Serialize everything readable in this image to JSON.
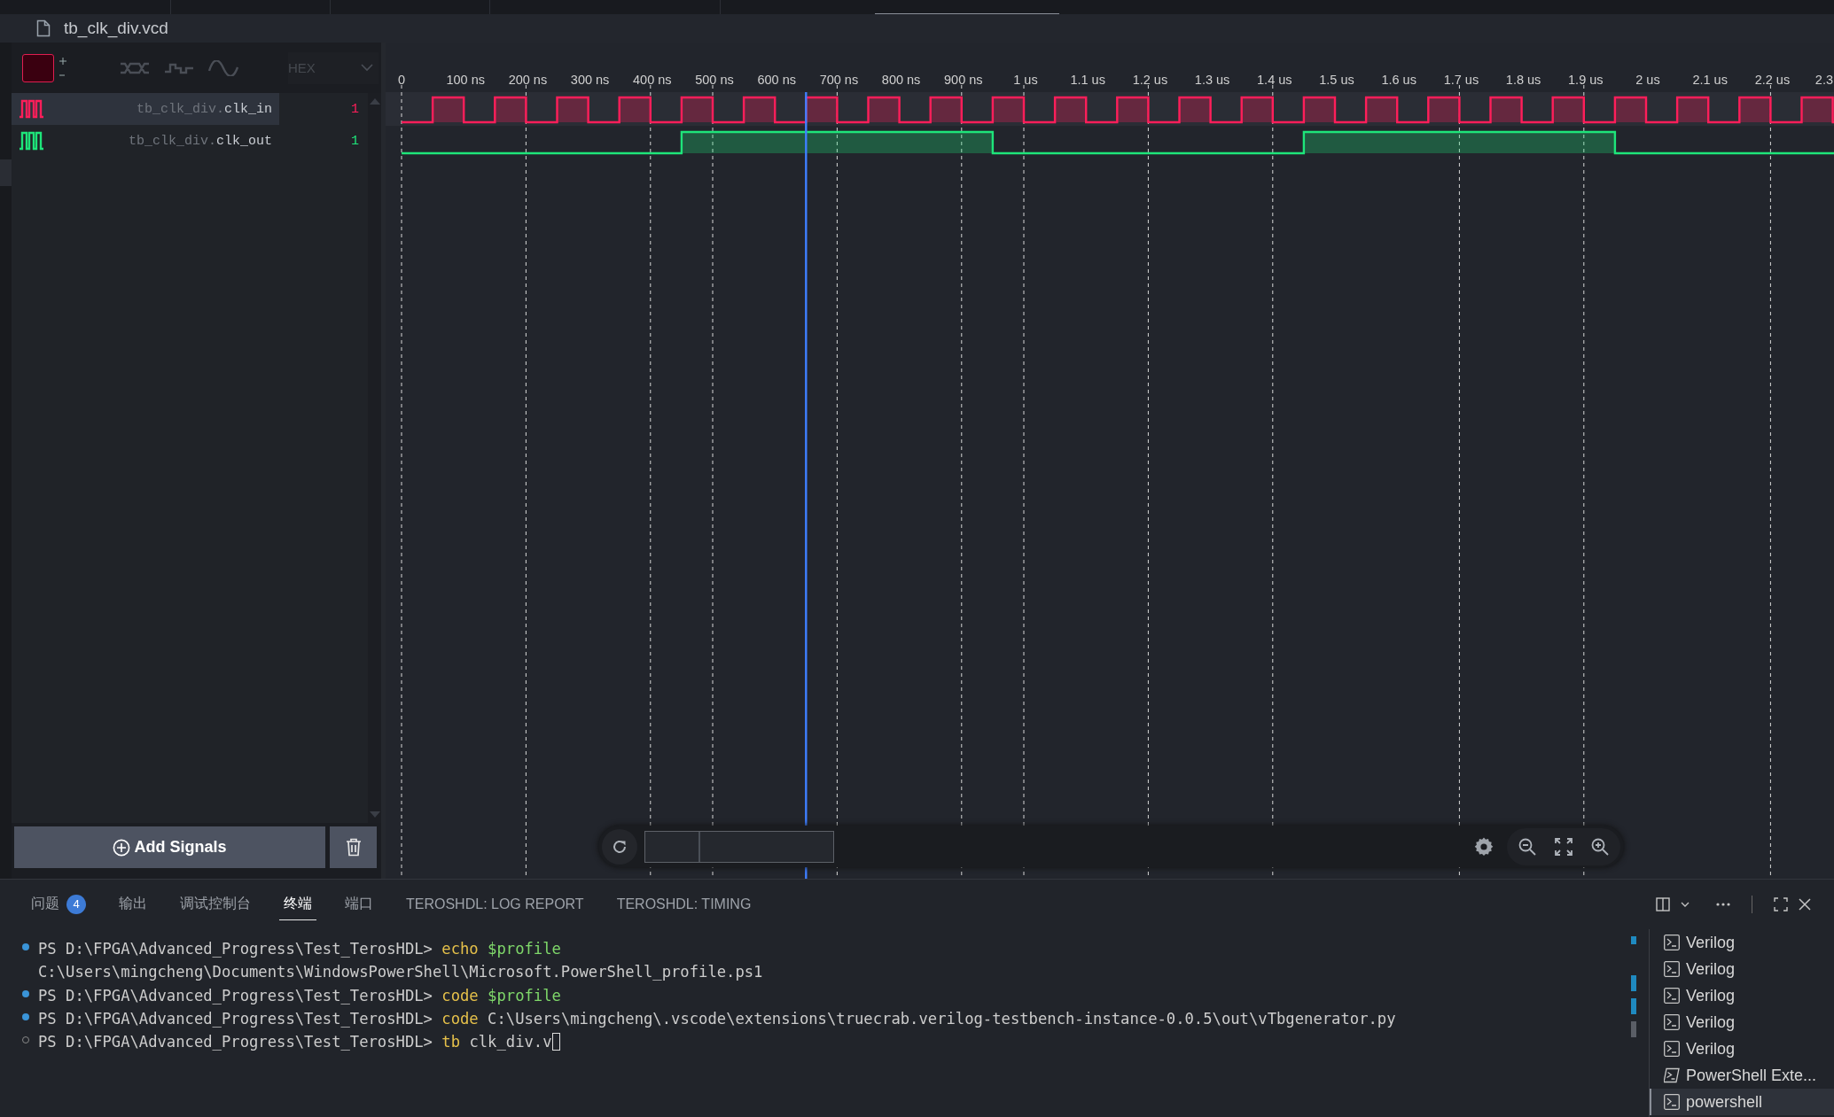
{
  "file": {
    "name": "tb_clk_div.vcd"
  },
  "toolbar": {
    "radix": "HEX",
    "disabled": true
  },
  "signals": [
    {
      "scope": "tb_clk_div.",
      "name": "clk_in",
      "value": "1",
      "color": "#ff1e5a",
      "selected": true
    },
    {
      "scope": "tb_clk_div.",
      "name": "clk_out",
      "value": "1",
      "color": "#1ee57a",
      "selected": false
    }
  ],
  "time_axis": [
    "0",
    "100 ns",
    "200 ns",
    "300 ns",
    "400 ns",
    "500 ns",
    "600 ns",
    "700 ns",
    "800 ns",
    "900 ns",
    "1 us",
    "1.1 us",
    "1.2 us",
    "1.3 us",
    "1.4 us",
    "1.5 us",
    "1.6 us",
    "1.7 us",
    "1.8 us",
    "1.9 us",
    "2 us",
    "2.1 us",
    "2.2 us",
    "2.3"
  ],
  "add_signals": {
    "label": "Add Signals"
  },
  "panel_tabs": [
    {
      "label": "问题",
      "badge": "4",
      "selected": false
    },
    {
      "label": "输出",
      "selected": false
    },
    {
      "label": "调试控制台",
      "selected": false
    },
    {
      "label": "终端",
      "selected": true
    },
    {
      "label": "端口",
      "selected": false
    },
    {
      "label": "TEROSHDL: LOG REPORT",
      "selected": false
    },
    {
      "label": "TEROSHDL: TIMING",
      "selected": false
    }
  ],
  "terminal_lines": [
    {
      "kind": "done",
      "cursor": false,
      "parts": [
        {
          "kind": "prompt",
          "text": "PS D:\\FPGA\\Advanced_Progress\\Test_TerosHDL>"
        },
        {
          "kind": "command",
          "text": "echo"
        },
        {
          "kind": "variable",
          "text": "$profile"
        }
      ]
    },
    {
      "kind": "output",
      "cursor": false,
      "parts": [
        {
          "kind": "output",
          "text": "C:\\Users\\mingcheng\\Documents\\WindowsPowerShell\\Microsoft.PowerShell_profile.ps1"
        }
      ]
    },
    {
      "kind": "done",
      "cursor": false,
      "parts": [
        {
          "kind": "prompt",
          "text": "PS D:\\FPGA\\Advanced_Progress\\Test_TerosHDL>"
        },
        {
          "kind": "command",
          "text": "code"
        },
        {
          "kind": "variable",
          "text": "$profile"
        }
      ]
    },
    {
      "kind": "done",
      "cursor": false,
      "parts": [
        {
          "kind": "prompt",
          "text": "PS D:\\FPGA\\Advanced_Progress\\Test_TerosHDL>"
        },
        {
          "kind": "command",
          "text": "code"
        },
        {
          "kind": "output",
          "text": "C:\\Users\\mingcheng\\.vscode\\extensions\\truecrab.verilog-testbench-instance-0.0.5\\out\\vTbgenerator.py"
        }
      ]
    },
    {
      "kind": "pending",
      "cursor": true,
      "parts": [
        {
          "kind": "prompt",
          "text": "PS D:\\FPGA\\Advanced_Progress\\Test_TerosHDL>"
        },
        {
          "kind": "command",
          "text": "tb"
        },
        {
          "kind": "output",
          "text": "clk_div.v"
        }
      ]
    }
  ],
  "terminals": [
    {
      "label": "Verilog",
      "kind": "shell",
      "selected": false
    },
    {
      "label": "Verilog",
      "kind": "shell",
      "selected": false
    },
    {
      "label": "Verilog",
      "kind": "shell",
      "selected": false
    },
    {
      "label": "Verilog",
      "kind": "shell",
      "selected": false
    },
    {
      "label": "Verilog",
      "kind": "shell",
      "selected": false
    },
    {
      "label": "PowerShell Exte...",
      "kind": "powershell",
      "selected": false
    },
    {
      "label": "powershell",
      "kind": "shell",
      "selected": true
    }
  ]
}
